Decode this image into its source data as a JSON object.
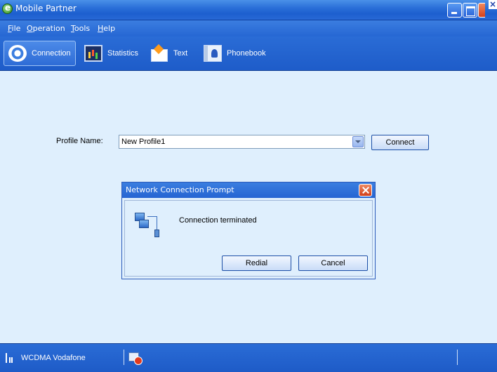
{
  "window": {
    "title": "Mobile Partner"
  },
  "menu": [
    "File",
    "Operation",
    "Tools",
    "Help"
  ],
  "toolbar": {
    "connection": "Connection",
    "statistics": "Statistics",
    "text": "Text",
    "phonebook": "Phonebook"
  },
  "profile": {
    "label": "Profile Name:",
    "value": "New Profile1",
    "connect_label": "Connect"
  },
  "dialog": {
    "title": "Network Connection Prompt",
    "message": "Connection terminated",
    "redial_label": "Redial",
    "cancel_label": "Cancel"
  },
  "status": {
    "network": "WCDMA Vodafone"
  }
}
